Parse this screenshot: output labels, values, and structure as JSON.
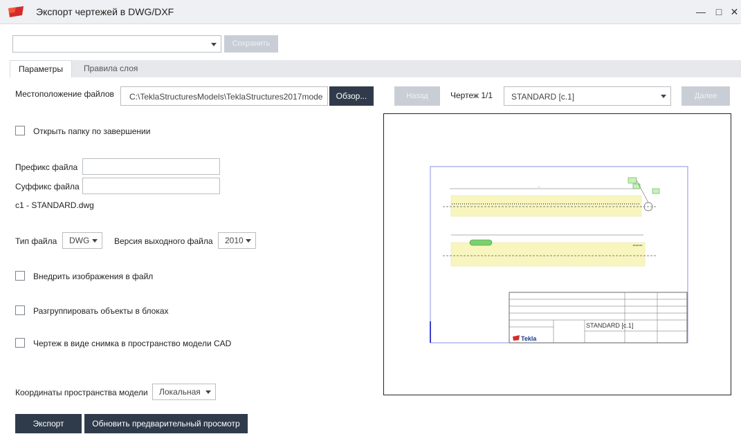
{
  "window": {
    "title": "Экспорт чертежей в DWG/DXF",
    "controls": {
      "minimize": "—",
      "maximize": "□",
      "close": "✕"
    }
  },
  "toolbar": {
    "settings_value": "",
    "save_label": "Сохранить"
  },
  "tabs": [
    {
      "label": "Параметры",
      "active": true
    },
    {
      "label": "Правила слоя",
      "active": false
    }
  ],
  "form": {
    "location_label": "Местоположение файлов",
    "location_value": "C:\\TeklaStructuresModels\\TeklaStructures2017mode",
    "browse_label": "Обзор...",
    "open_folder_label": "Открыть папку по завершении",
    "open_folder_checked": false,
    "prefix_label": "Префикс файла",
    "prefix_value": "",
    "suffix_label": "Суффикс файла",
    "suffix_value": "",
    "filename_preview": "c1 - STANDARD.dwg",
    "file_type_label": "Тип файла",
    "file_type_value": "DWG",
    "output_version_label": "Версия выходного файла",
    "output_version_value": "2010",
    "embed_images_label": "Внедрить изображения в файл",
    "embed_images_checked": false,
    "ungroup_label": "Разгруппировать объекты в блоках",
    "ungroup_checked": false,
    "snapshot_label": "Чертеж в виде снимка в пространство модели CAD",
    "snapshot_checked": false,
    "model_coords_label": "Координаты пространства модели",
    "model_coords_value": "Локальная"
  },
  "actions": {
    "export_label": "Экспорт",
    "refresh_preview_label": "Обновить предварительный просмотр"
  },
  "preview_nav": {
    "back_label": "Назад",
    "counter": "Чертеж 1/1",
    "drawing_value": "STANDARD [c.1]",
    "next_label": "Далее"
  },
  "preview": {
    "title_block_name": "STANDARD [c.1]",
    "brand_name": "Tekla",
    "colors": {
      "frame": "#8a8fe0",
      "highlight": "#f4f08a",
      "tag": "#7bd16f"
    }
  }
}
